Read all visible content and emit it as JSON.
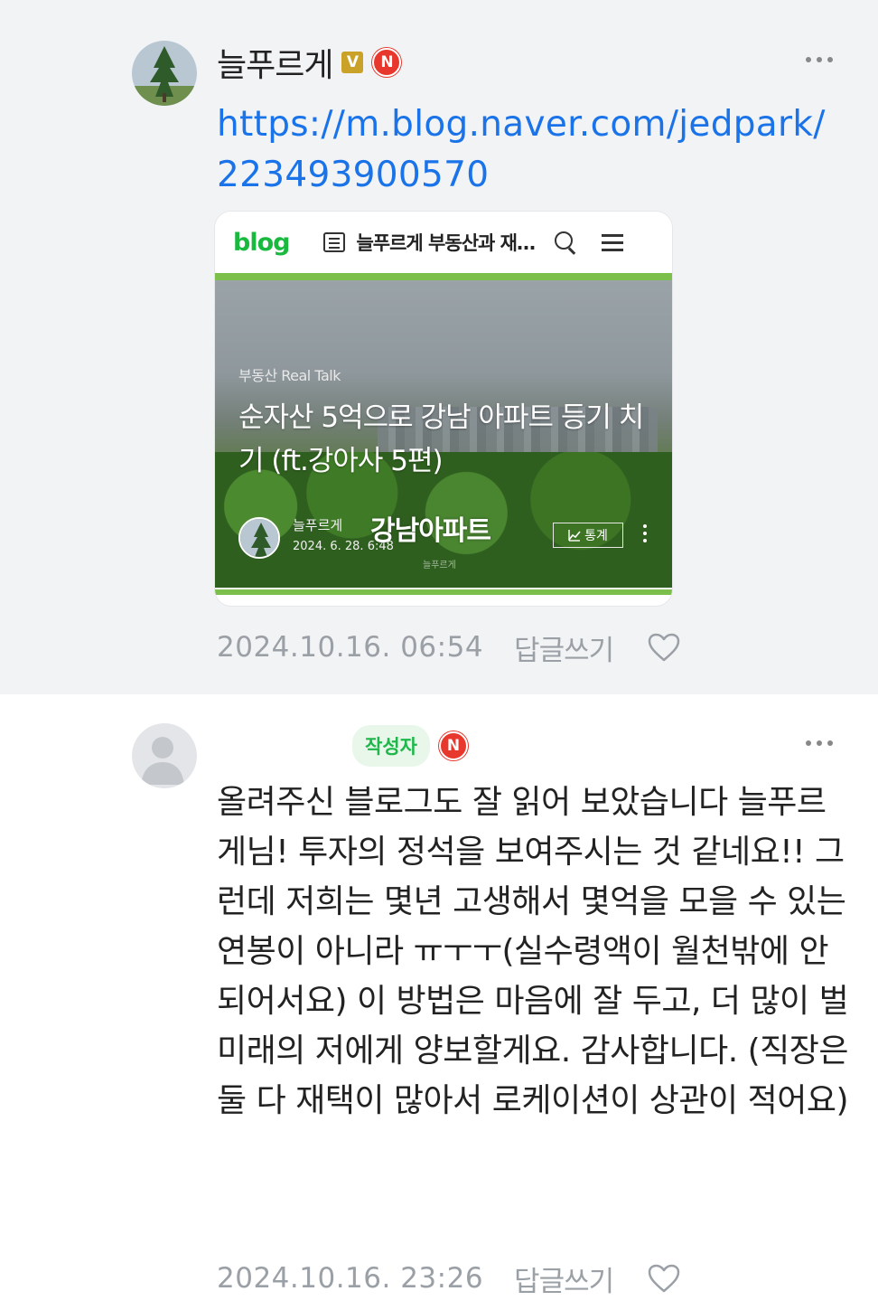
{
  "comment1": {
    "nickname": "늘푸르게",
    "verified_badge": "V",
    "n_badge": "N",
    "link": "https://m.blog.naver.com/jedpark/223493900570",
    "card": {
      "logo": "blog",
      "header_title": "늘푸르게 부동산과 재…",
      "category": "부동산 Real Talk",
      "title": "순자산 5억으로 강남 아파트 등기 치기 (ft.강아사 5편)",
      "author": "늘푸르게",
      "date": "2024. 6. 28. 6:48",
      "overlay": "강남아파트",
      "watermark": "늘푸르게",
      "stats_label": "통계"
    },
    "date": "2024.10.16. 06:54",
    "reply_label": "답글쓰기"
  },
  "comment2": {
    "author_tag": "작성자",
    "n_badge": "N",
    "text": "올려주신 블로그도 잘 읽어 보았습니다 늘푸르게님! 투자의 정석을 보여주시는 것 같네요!! 그런데 저희는 몇년 고생해서 몇억을 모을 수 있는 연봉이 아니라 ㅠㅜㅜ(실수령액이 월천밖에 안되어서요) 이 방법은 마음에 잘 두고, 더 많이 벌 미래의 저에게 양보할게요. 감사합니다. (직장은 둘 다 재택이 많아서 로케이션이 상관이 적어요)",
    "date": "2024.10.16. 23:26",
    "reply_label": "답글쓰기"
  },
  "icons": [
    "more-icon",
    "heart-icon",
    "search-icon",
    "menu-icon",
    "list-icon",
    "stats-icon"
  ],
  "colors": {
    "link": "#1a73e8",
    "accent_green": "#19b93f",
    "badge_red": "#e8372c",
    "meta_gray": "#9aa0a6"
  }
}
